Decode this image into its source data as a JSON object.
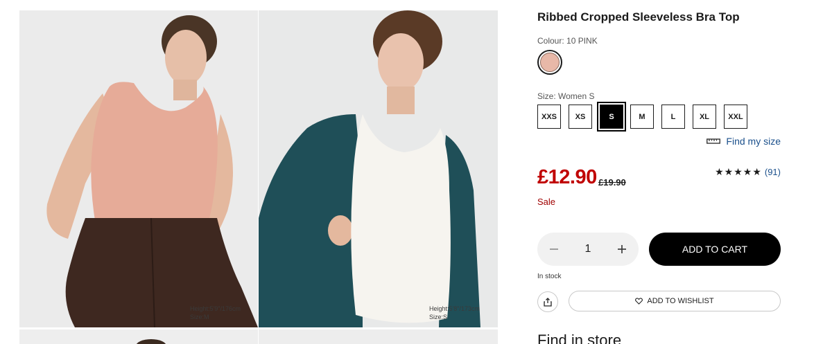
{
  "gallery": {
    "photos": [
      {
        "caption_height": "Height:5'9\"/176cm",
        "caption_size": "Size:M",
        "icon": "model-photo-pink-top"
      },
      {
        "caption_height": "Height:5'8\"/173cm",
        "caption_size": "Size:S",
        "icon": "model-photo-white-top"
      },
      {
        "icon": "model-photo"
      },
      {
        "icon": "model-photo"
      }
    ]
  },
  "product": {
    "title": "Ribbed Cropped Sleeveless Bra Top",
    "colour_label": "Colour: 10 PINK",
    "swatch_color": "#e8b8a8",
    "size_label": "Size: Women S",
    "sizes": [
      "XXS",
      "XS",
      "S",
      "M",
      "L",
      "XL",
      "XXL"
    ],
    "selected_size": "S",
    "find_size": "Find my size",
    "price": "£12.90",
    "old_price": "£19.90",
    "sale": "Sale",
    "stars": "★★★★★",
    "reviews": "(91)",
    "quantity": "1",
    "add_to_cart": "ADD TO CART",
    "stock": "In stock",
    "wishlist": "ADD TO WISHLIST",
    "find_in_store": "Find in store"
  },
  "colors": {
    "price_red": "#c00000",
    "link_blue": "#1a4f8b",
    "button_black": "#000000"
  }
}
